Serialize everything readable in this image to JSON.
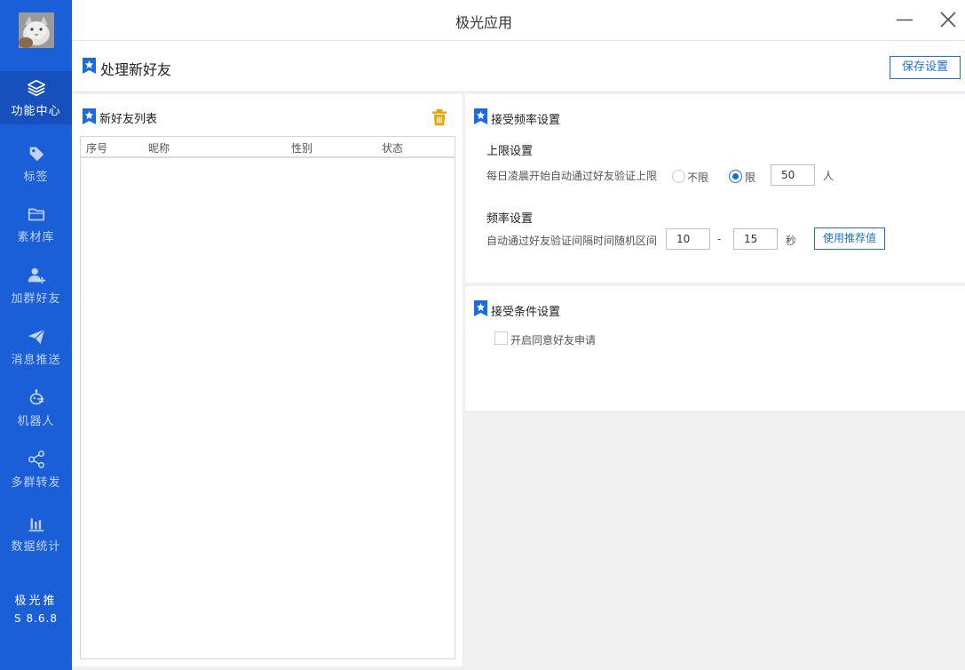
{
  "window": {
    "title": "极光应用",
    "minimize_icon": "minimize-icon",
    "close_icon": "close-icon"
  },
  "sidebar": {
    "accent_color": "#1a5fd8",
    "items": [
      {
        "label": "功能中心",
        "icon": "layers-icon",
        "active": true
      },
      {
        "label": "标签",
        "icon": "tag-icon",
        "active": false
      },
      {
        "label": "素材库",
        "icon": "folder-icon",
        "active": false
      },
      {
        "label": "加群好友",
        "icon": "add-user-icon",
        "active": false
      },
      {
        "label": "消息推送",
        "icon": "send-icon",
        "active": false
      },
      {
        "label": "机器人",
        "icon": "robot-icon",
        "active": false
      },
      {
        "label": "多群转发",
        "icon": "share-icon",
        "active": false
      },
      {
        "label": "数据统计",
        "icon": "bar-chart-icon",
        "active": false
      }
    ],
    "brand": "极光推",
    "version": "S 8.6.8"
  },
  "header": {
    "title": "处理新好友",
    "save_label": "保存设置"
  },
  "friend_list": {
    "title": "新好友列表",
    "delete_icon": "trash-icon",
    "columns": [
      "序号",
      "昵称",
      "性别",
      "状态"
    ],
    "rows": []
  },
  "frequency": {
    "title": "接受频率设置",
    "limit": {
      "title": "上限设置",
      "description": "每日凌晨开始自动通过好友验证上限",
      "option_unlimited": "不限",
      "option_limited": "限",
      "selected": "限",
      "value": "50",
      "unit": "人"
    },
    "rate": {
      "title": "频率设置",
      "description": "自动通过好友验证间隔时间随机区间",
      "min": "10",
      "separator": "-",
      "max": "15",
      "unit": "秒",
      "recommend_label": "使用推荐值"
    }
  },
  "conditions": {
    "title": "接受条件设置",
    "auto_accept_label": "开启同意好友申请",
    "auto_accept_checked": false
  }
}
